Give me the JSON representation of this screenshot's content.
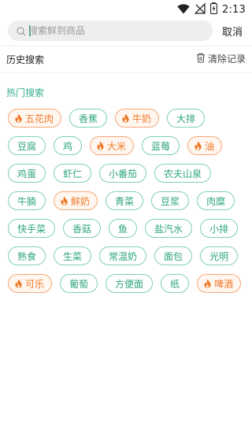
{
  "status_bar": {
    "time": "2:13",
    "icons": [
      "wifi-icon",
      "no-signal-icon",
      "battery-charging-icon"
    ]
  },
  "search": {
    "placeholder": "搜索鲜到商品",
    "value": "",
    "cancel_label": "取消"
  },
  "history": {
    "title": "历史搜索",
    "clear_label": "清除记录",
    "clear_icon": "trash-icon"
  },
  "hot": {
    "title": "热门搜索",
    "accent_color": "#35b08d",
    "hot_color": "#f07a2a",
    "tags": [
      {
        "label": "五花肉",
        "hot": true
      },
      {
        "label": "香蕉",
        "hot": false
      },
      {
        "label": "牛奶",
        "hot": true
      },
      {
        "label": "大排",
        "hot": false
      },
      {
        "label": "豆腐",
        "hot": false
      },
      {
        "label": "鸡",
        "hot": false
      },
      {
        "label": "大米",
        "hot": true
      },
      {
        "label": "蓝莓",
        "hot": false
      },
      {
        "label": "油",
        "hot": true
      },
      {
        "label": "鸡蛋",
        "hot": false
      },
      {
        "label": "虾仁",
        "hot": false
      },
      {
        "label": "小番茄",
        "hot": false
      },
      {
        "label": "农夫山泉",
        "hot": false
      },
      {
        "label": "牛腩",
        "hot": false
      },
      {
        "label": "鲜奶",
        "hot": true
      },
      {
        "label": "青菜",
        "hot": false
      },
      {
        "label": "豆浆",
        "hot": false
      },
      {
        "label": "肉糜",
        "hot": false
      },
      {
        "label": "快手菜",
        "hot": false
      },
      {
        "label": "香菇",
        "hot": false
      },
      {
        "label": "鱼",
        "hot": false
      },
      {
        "label": "盐汽水",
        "hot": false
      },
      {
        "label": "小排",
        "hot": false
      },
      {
        "label": "熟食",
        "hot": false
      },
      {
        "label": "生菜",
        "hot": false
      },
      {
        "label": "常温奶",
        "hot": false
      },
      {
        "label": "面包",
        "hot": false
      },
      {
        "label": "光明",
        "hot": false
      },
      {
        "label": "可乐",
        "hot": true
      },
      {
        "label": "葡萄",
        "hot": false
      },
      {
        "label": "方便面",
        "hot": false
      },
      {
        "label": "纸",
        "hot": false
      },
      {
        "label": "啤酒",
        "hot": true
      }
    ]
  }
}
